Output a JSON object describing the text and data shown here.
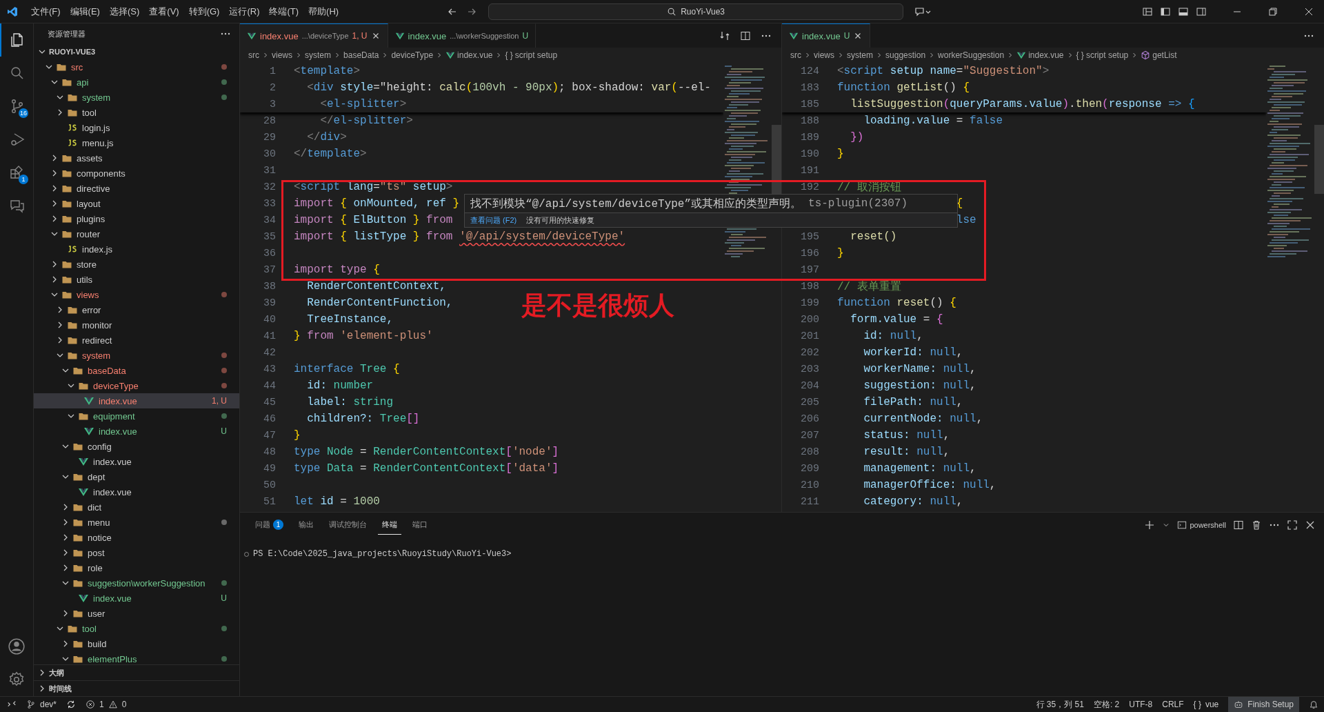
{
  "title_bar": {
    "menus": [
      "文件(F)",
      "编辑(E)",
      "选择(S)",
      "查看(V)",
      "转到(G)",
      "运行(R)",
      "终端(T)",
      "帮助(H)"
    ],
    "search": "RuoYi-Vue3"
  },
  "activity_bar": [
    {
      "kind": "explorer",
      "selected": true
    },
    {
      "kind": "search",
      "selected": false
    },
    {
      "kind": "source-control",
      "badge": "16",
      "selected": false
    },
    {
      "kind": "run-debug",
      "selected": false
    },
    {
      "kind": "extensions",
      "badge": "1",
      "selected": false
    },
    {
      "kind": "chat",
      "selected": false
    }
  ],
  "explorer": {
    "title": "资源管理器",
    "root": {
      "label": "RUOYI-VUE3",
      "expanded": true
    },
    "tree": [
      {
        "kind": "folder",
        "name": "src",
        "expanded": true,
        "color": "#f88070",
        "dot": true,
        "selected": false,
        "children": [
          {
            "kind": "folder",
            "name": "api",
            "expanded": true,
            "color": "#73c991",
            "dot": true,
            "selected": false,
            "children": [
              {
                "kind": "folder",
                "name": "system",
                "expanded": true,
                "color": "#73c991",
                "dot": true,
                "selected": false
              },
              {
                "kind": "folder",
                "name": "tool",
                "expanded": false,
                "color": "#cccccc",
                "dot": false,
                "selected": false
              },
              {
                "kind": "js",
                "name": "login.js",
                "color": "#cccccc",
                "dot": false,
                "selected": false
              },
              {
                "kind": "js",
                "name": "menu.js",
                "color": "#cccccc",
                "dot": false,
                "selected": false
              }
            ]
          },
          {
            "kind": "folder",
            "name": "assets",
            "expanded": false,
            "color": "#cccccc",
            "dot": false,
            "selected": false
          },
          {
            "kind": "folder",
            "name": "components",
            "expanded": false,
            "color": "#cccccc",
            "dot": false,
            "selected": false
          },
          {
            "kind": "folder",
            "name": "directive",
            "expanded": false,
            "color": "#cccccc",
            "dot": false,
            "selected": false
          },
          {
            "kind": "folder",
            "name": "layout",
            "expanded": false,
            "color": "#cccccc",
            "dot": false,
            "selected": false
          },
          {
            "kind": "folder",
            "name": "plugins",
            "expanded": false,
            "color": "#cccccc",
            "dot": false,
            "selected": false
          },
          {
            "kind": "folder",
            "name": "router",
            "expanded": true,
            "color": "#cccccc",
            "dot": false,
            "selected": false,
            "children": [
              {
                "kind": "js",
                "name": "index.js",
                "color": "#cccccc",
                "dot": false,
                "selected": false
              }
            ]
          },
          {
            "kind": "folder",
            "name": "store",
            "expanded": false,
            "color": "#cccccc",
            "dot": false,
            "selected": false
          },
          {
            "kind": "folder",
            "name": "utils",
            "expanded": false,
            "color": "#cccccc",
            "dot": false,
            "selected": false
          },
          {
            "kind": "folder",
            "name": "views",
            "expanded": true,
            "color": "#f88070",
            "dot": true,
            "selected": false,
            "children": [
              {
                "kind": "folder",
                "name": "error",
                "expanded": false,
                "color": "#cccccc",
                "dot": false,
                "selected": false
              },
              {
                "kind": "folder",
                "name": "monitor",
                "expanded": false,
                "color": "#cccccc",
                "dot": false,
                "selected": false
              },
              {
                "kind": "folder",
                "name": "redirect",
                "expanded": false,
                "color": "#cccccc",
                "dot": false,
                "selected": false
              },
              {
                "kind": "folder",
                "name": "system",
                "expanded": true,
                "color": "#f88070",
                "dot": true,
                "selected": false,
                "children": [
                  {
                    "kind": "folder",
                    "name": "baseData",
                    "expanded": true,
                    "color": "#f88070",
                    "dot": true,
                    "selected": false,
                    "children": [
                      {
                        "kind": "folder",
                        "name": "deviceType",
                        "expanded": true,
                        "color": "#f88070",
                        "dot": true,
                        "selected": false,
                        "children": [
                          {
                            "kind": "vue",
                            "name": "index.vue",
                            "color": "#f88070",
                            "dot": false,
                            "badge": "1, U",
                            "selected": true
                          }
                        ]
                      },
                      {
                        "kind": "folder",
                        "name": "equipment",
                        "expanded": true,
                        "color": "#73c991",
                        "dot": true,
                        "selected": false,
                        "children": [
                          {
                            "kind": "vue",
                            "name": "index.vue",
                            "color": "#73c991",
                            "dot": false,
                            "badge": "U",
                            "selected": false
                          }
                        ]
                      }
                    ]
                  },
                  {
                    "kind": "folder",
                    "name": "config",
                    "expanded": true,
                    "color": "#cccccc",
                    "dot": false,
                    "selected": false,
                    "children": [
                      {
                        "kind": "vue",
                        "name": "index.vue",
                        "color": "#cccccc",
                        "dot": false,
                        "selected": false
                      }
                    ]
                  },
                  {
                    "kind": "folder",
                    "name": "dept",
                    "expanded": true,
                    "color": "#cccccc",
                    "dot": false,
                    "selected": false,
                    "children": [
                      {
                        "kind": "vue",
                        "name": "index.vue",
                        "color": "#cccccc",
                        "dot": false,
                        "selected": false
                      }
                    ]
                  },
                  {
                    "kind": "folder",
                    "name": "dict",
                    "expanded": false,
                    "color": "#cccccc",
                    "dot": false,
                    "selected": false
                  },
                  {
                    "kind": "folder",
                    "name": "menu",
                    "expanded": false,
                    "color": "#cccccc",
                    "dot": true,
                    "selected": false
                  },
                  {
                    "kind": "folder",
                    "name": "notice",
                    "expanded": false,
                    "color": "#cccccc",
                    "dot": false,
                    "selected": false
                  },
                  {
                    "kind": "folder",
                    "name": "post",
                    "expanded": false,
                    "color": "#cccccc",
                    "dot": false,
                    "selected": false
                  },
                  {
                    "kind": "folder",
                    "name": "role",
                    "expanded": false,
                    "color": "#cccccc",
                    "dot": false,
                    "selected": false
                  },
                  {
                    "kind": "folder",
                    "name": "suggestion\\workerSuggestion",
                    "expanded": true,
                    "color": "#73c991",
                    "dot": true,
                    "selected": false,
                    "children": [
                      {
                        "kind": "vue",
                        "name": "index.vue",
                        "color": "#73c991",
                        "dot": false,
                        "badge": "U",
                        "selected": false
                      }
                    ]
                  },
                  {
                    "kind": "folder",
                    "name": "user",
                    "expanded": false,
                    "color": "#cccccc",
                    "dot": false,
                    "selected": false
                  }
                ]
              },
              {
                "kind": "folder",
                "name": "tool",
                "expanded": true,
                "color": "#73c991",
                "dot": true,
                "selected": false,
                "children": [
                  {
                    "kind": "folder",
                    "name": "build",
                    "expanded": false,
                    "color": "#cccccc",
                    "dot": false,
                    "selected": false
                  },
                  {
                    "kind": "folder",
                    "name": "elementPlus",
                    "expanded": true,
                    "color": "#73c991",
                    "dot": true,
                    "selected": false
                  }
                ]
              }
            ]
          }
        ]
      }
    ],
    "sections": [
      {
        "label": "大纲",
        "expanded": false
      },
      {
        "label": "时间线",
        "expanded": false
      }
    ]
  },
  "editors": [
    {
      "tabs": [
        {
          "label": "index.vue",
          "desc": "...\\deviceType",
          "badge": "1, U",
          "color": "#f88070",
          "selected": true
        },
        {
          "label": "index.vue",
          "desc": "...\\workerSuggestion",
          "badge": "U",
          "color": "#73c991",
          "selected": false
        }
      ],
      "breadcrumbs": [
        {
          "kind": "text",
          "text": "src"
        },
        {
          "kind": "text",
          "text": "views"
        },
        {
          "kind": "text",
          "text": "system"
        },
        {
          "kind": "text",
          "text": "baseData"
        },
        {
          "kind": "text",
          "text": "deviceType"
        },
        {
          "kind": "vue",
          "text": "index.vue"
        },
        {
          "kind": "braces",
          "icon": "{ }",
          "text": "script setup"
        }
      ],
      "sticky": [
        {
          "n": "1",
          "tokens": [
            {
              "text": "<",
              "kind": "p"
            },
            {
              "text": "template",
              "kind": "tag"
            },
            {
              "text": ">",
              "kind": "p"
            }
          ]
        },
        {
          "n": "2",
          "tokens": [
            {
              "text": "  <",
              "kind": "p"
            },
            {
              "text": "div",
              "kind": "tag"
            },
            {
              "text": " style",
              "kind": "attr"
            },
            {
              "text": "=",
              "kind": "t"
            },
            {
              "text": "\"height: ",
              "kind": "t"
            },
            {
              "text": "calc",
              "kind": "fn"
            },
            {
              "text": "(",
              "kind": "brace"
            },
            {
              "text": "100vh - 90px",
              "kind": "num"
            },
            {
              "text": ")",
              "kind": "brace"
            },
            {
              "text": "; box-shadow: ",
              "kind": "t"
            },
            {
              "text": "var",
              "kind": "fn"
            },
            {
              "text": "(",
              "kind": "brace"
            },
            {
              "text": "--el-",
              "kind": "t"
            }
          ]
        },
        {
          "n": "3",
          "tokens": [
            {
              "text": "    <",
              "kind": "p"
            },
            {
              "text": "el-splitter",
              "kind": "tag"
            },
            {
              "text": ">",
              "kind": "p"
            }
          ]
        }
      ],
      "lines": [
        {
          "n": "28",
          "tokens": [
            {
              "text": "    </",
              "kind": "p"
            },
            {
              "text": "el-splitter",
              "kind": "tag"
            },
            {
              "text": ">",
              "kind": "p"
            }
          ]
        },
        {
          "n": "29",
          "tokens": [
            {
              "text": "  </",
              "kind": "p"
            },
            {
              "text": "div",
              "kind": "tag"
            },
            {
              "text": ">",
              "kind": "p"
            }
          ]
        },
        {
          "n": "30",
          "tokens": [
            {
              "text": "</",
              "kind": "p"
            },
            {
              "text": "template",
              "kind": "tag"
            },
            {
              "text": ">",
              "kind": "p"
            }
          ]
        },
        {
          "n": "31"
        },
        {
          "n": "32",
          "tokens": [
            {
              "text": "<",
              "kind": "p"
            },
            {
              "text": "script",
              "kind": "tag"
            },
            {
              "text": " lang",
              "kind": "attr"
            },
            {
              "text": "=",
              "kind": "t"
            },
            {
              "text": "\"ts\"",
              "kind": "str"
            },
            {
              "text": " setup",
              "kind": "attr"
            },
            {
              "text": ">",
              "kind": "p"
            }
          ]
        },
        {
          "n": "33",
          "tokens": [
            {
              "text": "import ",
              "kind": "ctrl"
            },
            {
              "text": "{",
              "kind": "brace"
            },
            {
              "text": " onMounted, ref ",
              "kind": "var"
            },
            {
              "text": "}",
              "kind": "brace"
            }
          ]
        },
        {
          "n": "34",
          "tokens": [
            {
              "text": "import ",
              "kind": "ctrl"
            },
            {
              "text": "{",
              "kind": "brace"
            },
            {
              "text": " ElButton ",
              "kind": "var"
            },
            {
              "text": "}",
              "kind": "brace"
            },
            {
              "text": " from",
              "kind": "ctrl"
            }
          ]
        },
        {
          "n": "35",
          "tokens": [
            {
              "text": "import ",
              "kind": "ctrl"
            },
            {
              "text": "{",
              "kind": "brace"
            },
            {
              "text": " listType ",
              "kind": "var"
            },
            {
              "text": "}",
              "kind": "brace"
            },
            {
              "text": " from ",
              "kind": "ctrl"
            },
            {
              "text": "'@/api/system/deviceType'",
              "kind": "err"
            }
          ]
        },
        {
          "n": "36"
        },
        {
          "n": "37",
          "tokens": [
            {
              "text": "import type ",
              "kind": "ctrl"
            },
            {
              "text": "{",
              "kind": "brace"
            }
          ]
        },
        {
          "n": "38",
          "tokens": [
            {
              "text": "  RenderContentContext,",
              "kind": "var"
            }
          ]
        },
        {
          "n": "39",
          "tokens": [
            {
              "text": "  RenderContentFunction,",
              "kind": "var"
            }
          ]
        },
        {
          "n": "40",
          "tokens": [
            {
              "text": "  TreeInstance,",
              "kind": "var"
            }
          ]
        },
        {
          "n": "41",
          "tokens": [
            {
              "text": "}",
              "kind": "brace"
            },
            {
              "text": " from ",
              "kind": "ctrl"
            },
            {
              "text": "'element-plus'",
              "kind": "str"
            }
          ]
        },
        {
          "n": "42"
        },
        {
          "n": "43",
          "tokens": [
            {
              "text": "interface ",
              "kind": "kw"
            },
            {
              "text": "Tree ",
              "kind": "type"
            },
            {
              "text": "{",
              "kind": "brace"
            }
          ]
        },
        {
          "n": "44",
          "tokens": [
            {
              "text": "  id: ",
              "kind": "var"
            },
            {
              "text": "number",
              "kind": "type"
            }
          ]
        },
        {
          "n": "45",
          "tokens": [
            {
              "text": "  label: ",
              "kind": "var"
            },
            {
              "text": "string",
              "kind": "type"
            }
          ]
        },
        {
          "n": "46",
          "tokens": [
            {
              "text": "  children?: ",
              "kind": "var"
            },
            {
              "text": "Tree",
              "kind": "type"
            },
            {
              "text": "[]",
              "kind": "pink"
            }
          ]
        },
        {
          "n": "47",
          "tokens": [
            {
              "text": "}",
              "kind": "brace"
            }
          ]
        },
        {
          "n": "48",
          "tokens": [
            {
              "text": "type ",
              "kind": "kw"
            },
            {
              "text": "Node ",
              "kind": "type"
            },
            {
              "text": "= ",
              "kind": "t"
            },
            {
              "text": "RenderContentContext",
              "kind": "type"
            },
            {
              "text": "[",
              "kind": "pink"
            },
            {
              "text": "'node'",
              "kind": "str"
            },
            {
              "text": "]",
              "kind": "pink"
            }
          ]
        },
        {
          "n": "49",
          "tokens": [
            {
              "text": "type ",
              "kind": "kw"
            },
            {
              "text": "Data ",
              "kind": "type"
            },
            {
              "text": "= ",
              "kind": "t"
            },
            {
              "text": "RenderContentContext",
              "kind": "type"
            },
            {
              "text": "[",
              "kind": "pink"
            },
            {
              "text": "'data'",
              "kind": "str"
            },
            {
              "text": "]",
              "kind": "pink"
            }
          ]
        },
        {
          "n": "50"
        },
        {
          "n": "51",
          "tokens": [
            {
              "text": "let ",
              "kind": "kw"
            },
            {
              "text": "id ",
              "kind": "var"
            },
            {
              "text": "= ",
              "kind": "t"
            },
            {
              "text": "1000",
              "kind": "num"
            }
          ]
        }
      ]
    },
    {
      "tabs": [
        {
          "label": "index.vue",
          "badge": "U",
          "color": "#73c991",
          "selected": true
        }
      ],
      "breadcrumbs": [
        {
          "kind": "text",
          "text": "src"
        },
        {
          "kind": "text",
          "text": "views"
        },
        {
          "kind": "text",
          "text": "system"
        },
        {
          "kind": "text",
          "text": "suggestion"
        },
        {
          "kind": "text",
          "text": "workerSuggestion"
        },
        {
          "kind": "vue",
          "text": "index.vue"
        },
        {
          "kind": "braces",
          "icon": "{ }",
          "text": "script setup"
        },
        {
          "kind": "method",
          "text": "getList"
        }
      ],
      "sticky": [
        {
          "n": "124",
          "tokens": [
            {
              "text": "<",
              "kind": "p"
            },
            {
              "text": "script",
              "kind": "tag"
            },
            {
              "text": " setup name",
              "kind": "attr"
            },
            {
              "text": "=",
              "kind": "t"
            },
            {
              "text": "\"Suggestion\"",
              "kind": "str"
            },
            {
              "text": ">",
              "kind": "p"
            }
          ]
        },
        {
          "n": "183",
          "tokens": [
            {
              "text": "function ",
              "kind": "kw"
            },
            {
              "text": "getList",
              "kind": "fn"
            },
            {
              "text": "() ",
              "kind": "t"
            },
            {
              "text": "{",
              "kind": "brace"
            }
          ]
        },
        {
          "n": "185",
          "tokens": [
            {
              "text": "  listSuggestion",
              "kind": "fn"
            },
            {
              "text": "(",
              "kind": "pink"
            },
            {
              "text": "queryParams",
              "kind": "var"
            },
            {
              "text": ".value",
              "kind": "var"
            },
            {
              "text": ")",
              "kind": "pink"
            },
            {
              "text": ".",
              "kind": "t"
            },
            {
              "text": "then",
              "kind": "fn"
            },
            {
              "text": "(",
              "kind": "pink"
            },
            {
              "text": "response ",
              "kind": "var"
            },
            {
              "text": "=> ",
              "kind": "kw"
            },
            {
              "text": "{",
              "kind": "blue"
            }
          ]
        }
      ],
      "lines": [
        {
          "n": "188",
          "tokens": [
            {
              "text": "    loading",
              "kind": "var"
            },
            {
              "text": ".value ",
              "kind": "var"
            },
            {
              "text": "= ",
              "kind": "t"
            },
            {
              "text": "false",
              "kind": "kw"
            }
          ]
        },
        {
          "n": "189",
          "tokens": [
            {
              "text": "  })",
              "kind": "pink"
            }
          ]
        },
        {
          "n": "190",
          "tokens": [
            {
              "text": "}",
              "kind": "brace"
            }
          ]
        },
        {
          "n": "191"
        },
        {
          "n": "192",
          "tokens": [
            {
              "text": "// 取消按钮",
              "kind": "comment"
            }
          ]
        },
        {
          "tokens": [
            {
              "text": "{",
              "kind": "brace"
            }
          ]
        },
        {
          "tokens": [
            {
              "text": "lse",
              "kind": "kw"
            }
          ]
        },
        {
          "n": "195",
          "tokens": [
            {
              "text": "  reset()",
              "kind": "fn"
            }
          ]
        },
        {
          "n": "196",
          "tokens": [
            {
              "text": "}",
              "kind": "brace"
            }
          ]
        },
        {
          "n": "197"
        },
        {
          "n": "198",
          "tokens": [
            {
              "text": "// 表单重置",
              "kind": "comment"
            }
          ]
        },
        {
          "n": "199",
          "tokens": [
            {
              "text": "function ",
              "kind": "kw"
            },
            {
              "text": "reset",
              "kind": "fn"
            },
            {
              "text": "() ",
              "kind": "t"
            },
            {
              "text": "{",
              "kind": "brace"
            }
          ]
        },
        {
          "n": "200",
          "tokens": [
            {
              "text": "  form",
              "kind": "var"
            },
            {
              "text": ".value ",
              "kind": "var"
            },
            {
              "text": "= ",
              "kind": "t"
            },
            {
              "text": "{",
              "kind": "pink"
            }
          ]
        },
        {
          "n": "201",
          "tokens": [
            {
              "text": "    id: ",
              "kind": "var"
            },
            {
              "text": "null",
              "kind": "kw"
            },
            {
              "text": ",",
              "kind": "t"
            }
          ]
        },
        {
          "n": "202",
          "tokens": [
            {
              "text": "    workerId: ",
              "kind": "var"
            },
            {
              "text": "null",
              "kind": "kw"
            },
            {
              "text": ",",
              "kind": "t"
            }
          ]
        },
        {
          "n": "203",
          "tokens": [
            {
              "text": "    workerName: ",
              "kind": "var"
            },
            {
              "text": "null",
              "kind": "kw"
            },
            {
              "text": ",",
              "kind": "t"
            }
          ]
        },
        {
          "n": "204",
          "tokens": [
            {
              "text": "    suggestion: ",
              "kind": "var"
            },
            {
              "text": "null",
              "kind": "kw"
            },
            {
              "text": ",",
              "kind": "t"
            }
          ]
        },
        {
          "n": "205",
          "tokens": [
            {
              "text": "    filePath: ",
              "kind": "var"
            },
            {
              "text": "null",
              "kind": "kw"
            },
            {
              "text": ",",
              "kind": "t"
            }
          ]
        },
        {
          "n": "206",
          "tokens": [
            {
              "text": "    currentNode: ",
              "kind": "var"
            },
            {
              "text": "null",
              "kind": "kw"
            },
            {
              "text": ",",
              "kind": "t"
            }
          ]
        },
        {
          "n": "207",
          "tokens": [
            {
              "text": "    status: ",
              "kind": "var"
            },
            {
              "text": "null",
              "kind": "kw"
            },
            {
              "text": ",",
              "kind": "t"
            }
          ]
        },
        {
          "n": "208",
          "tokens": [
            {
              "text": "    result: ",
              "kind": "var"
            },
            {
              "text": "null",
              "kind": "kw"
            },
            {
              "text": ",",
              "kind": "t"
            }
          ]
        },
        {
          "n": "209",
          "tokens": [
            {
              "text": "    management: ",
              "kind": "var"
            },
            {
              "text": "null",
              "kind": "kw"
            },
            {
              "text": ",",
              "kind": "t"
            }
          ]
        },
        {
          "n": "210",
          "tokens": [
            {
              "text": "    managerOffice: ",
              "kind": "var"
            },
            {
              "text": "null",
              "kind": "kw"
            },
            {
              "text": ",",
              "kind": "t"
            }
          ]
        },
        {
          "n": "211",
          "tokens": [
            {
              "text": "    category: ",
              "kind": "var"
            },
            {
              "text": "null",
              "kind": "kw"
            },
            {
              "text": ",",
              "kind": "t"
            }
          ]
        }
      ]
    }
  ],
  "hover": {
    "message": "找不到模块“@/api/system/deviceType”或其相应的类型声明。",
    "source": "ts-plugin(2307)",
    "link": "查看问题 (F2)",
    "note": "没有可用的快速修复"
  },
  "annotation": {
    "text": "是不是很烦人"
  },
  "panel": {
    "tabs": [
      {
        "label": "问题",
        "badge": "1",
        "selected": false
      },
      {
        "label": "输出",
        "selected": false
      },
      {
        "label": "调试控制台",
        "selected": false
      },
      {
        "label": "终端",
        "selected": true
      },
      {
        "label": "端口",
        "selected": false
      }
    ],
    "shell": "powershell",
    "terminal": "PS E:\\Code\\2025_java_projects\\RuoyiStudy\\RuoYi-Vue3>"
  },
  "status_bar": {
    "branch": "dev*",
    "errors": "1",
    "warnings": "0",
    "items": [
      "行 35，列 51",
      "空格: 2",
      "UTF-8",
      "CRLF"
    ],
    "language_icon": "{ }",
    "language": "vue",
    "finish_setup": "Finish Setup"
  }
}
